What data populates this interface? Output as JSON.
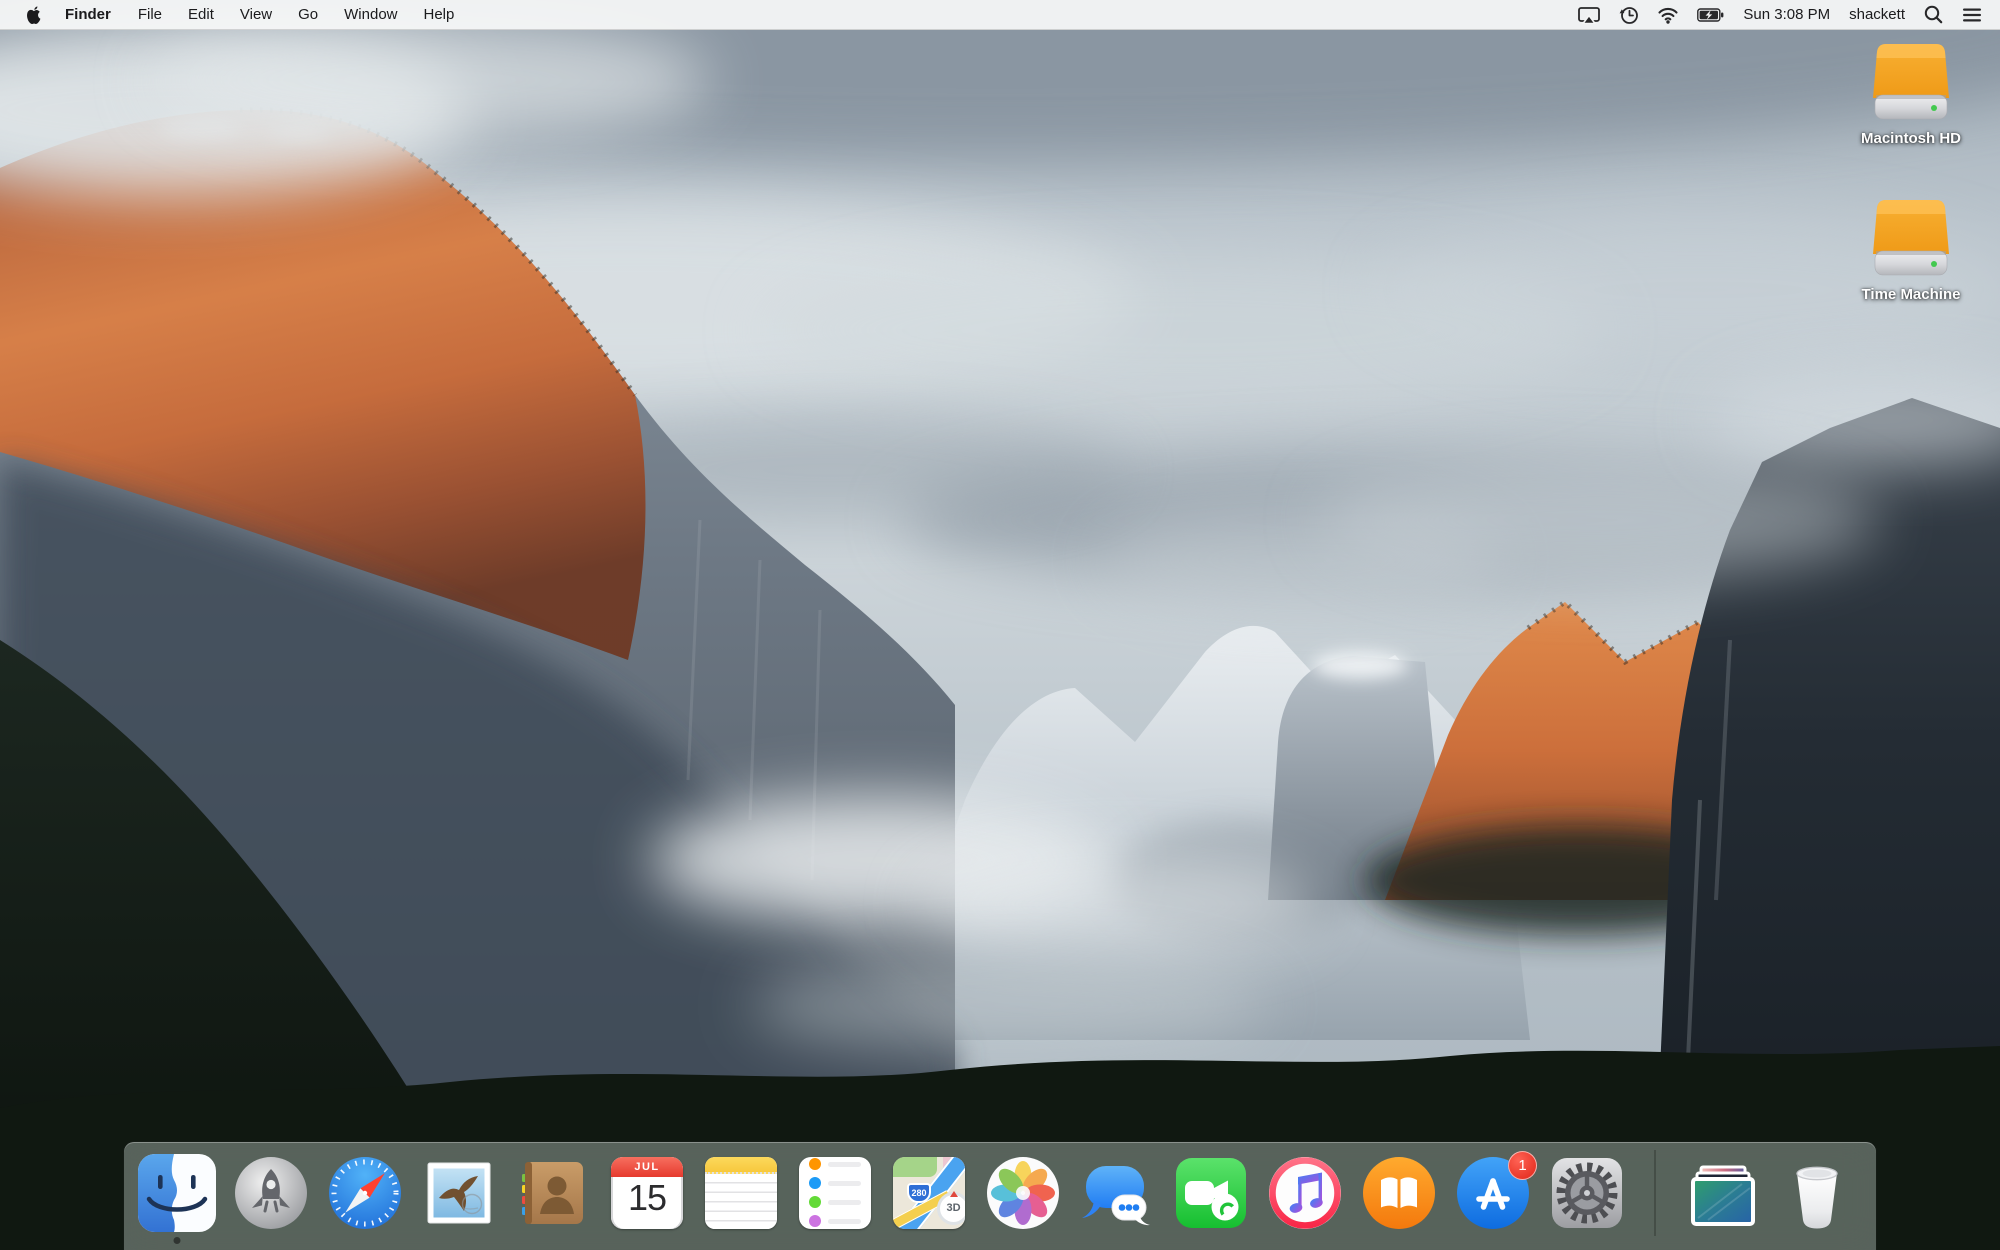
{
  "menu_bar": {
    "menus": [
      "Finder",
      "File",
      "Edit",
      "View",
      "Go",
      "Window",
      "Help"
    ],
    "active_app": "Finder",
    "status": {
      "clock": "Sun 3:08 PM",
      "username": "shackett"
    }
  },
  "desktop": {
    "wallpaper_name": "el-capitan-yosemite",
    "icons": [
      {
        "label": "Macintosh HD"
      },
      {
        "label": "Time Machine"
      }
    ]
  },
  "dock": {
    "items": [
      "Finder",
      "Launchpad",
      "Safari",
      "Mail",
      "Contacts",
      "Calendar",
      "Notes",
      "Reminders",
      "Maps",
      "Photos",
      "Messages",
      "FaceTime",
      "iTunes",
      "iBooks",
      "App Store",
      "System Preferences",
      "Desktop Pictures",
      "Trash"
    ],
    "running_apps": [
      "Finder"
    ],
    "calendar": {
      "month": "JUL",
      "day": "15"
    },
    "maps": {
      "route_shield": "280",
      "mode_badge": "3D"
    },
    "app_store_badge": "1"
  },
  "colors": {
    "menu_bar_bg": "#f6f7f7",
    "dock_bg": "rgba(141,153,146,0.58)",
    "badge_red": "#e02518",
    "calendar_red": "#e63a2e",
    "drive_orange": "#f3a329",
    "desktop_label": "#ffffff"
  }
}
